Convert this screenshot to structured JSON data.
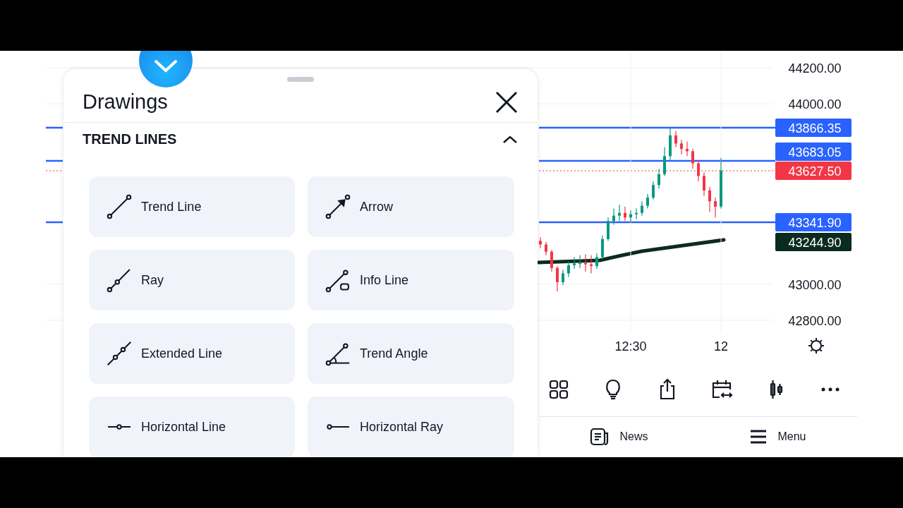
{
  "chart": {
    "chart_data": {
      "type": "candlestick",
      "categories": [
        null,
        null,
        null,
        null,
        null,
        null,
        null,
        null,
        null,
        null,
        null,
        null,
        null,
        null,
        null,
        null,
        "12:30",
        null,
        null,
        null,
        null,
        null,
        null,
        null,
        null,
        null,
        null,
        null,
        null,
        null,
        null,
        null,
        "12"
      ],
      "ohlc": [
        [
          43240,
          43260,
          43200,
          43220
        ],
        [
          43220,
          43235,
          43160,
          43180
        ],
        [
          43180,
          43190,
          43070,
          43090
        ],
        [
          43090,
          43100,
          42960,
          43011
        ],
        [
          43011,
          43080,
          42995,
          43060
        ],
        [
          43060,
          43125,
          43040,
          43105
        ],
        [
          43105,
          43150,
          43085,
          43115
        ],
        [
          43115,
          43160,
          43090,
          43118
        ],
        [
          43118,
          43165,
          43070,
          43110
        ],
        [
          43110,
          43160,
          43060,
          43100
        ],
        [
          43100,
          43170,
          43085,
          43150
        ],
        [
          43150,
          43270,
          43140,
          43250
        ],
        [
          43250,
          43370,
          43240,
          43350
        ],
        [
          43350,
          43420,
          43330,
          43380
        ],
        [
          43380,
          43440,
          43350,
          43395
        ],
        [
          43395,
          43430,
          43350,
          43370
        ],
        [
          43370,
          43410,
          43340,
          43388
        ],
        [
          43388,
          43420,
          43360,
          43395
        ],
        [
          43395,
          43460,
          43380,
          43435
        ],
        [
          43435,
          43500,
          43420,
          43480
        ],
        [
          43480,
          43570,
          43470,
          43550
        ],
        [
          43550,
          43640,
          43530,
          43610
        ],
        [
          43610,
          43760,
          43600,
          43710
        ],
        [
          43710,
          43870,
          43690,
          43825
        ],
        [
          43825,
          43850,
          43760,
          43780
        ],
        [
          43780,
          43800,
          43720,
          43750
        ],
        [
          43750,
          43790,
          43710,
          43737
        ],
        [
          43737,
          43750,
          43640,
          43670
        ],
        [
          43670,
          43690,
          43570,
          43600
        ],
        [
          43600,
          43620,
          43490,
          43520
        ],
        [
          43520,
          43540,
          43400,
          43460
        ],
        [
          43460,
          43480,
          43370,
          43430
        ],
        [
          43430,
          43700,
          43420,
          43630
        ]
      ],
      "ylim": [
        42737,
        44294
      ],
      "yticks": [
        {
          "value": 44200,
          "label": "44200.00"
        },
        {
          "value": 44000,
          "label": "44000.00"
        },
        {
          "value": 43000,
          "label": "43000.00"
        },
        {
          "value": 42800,
          "label": "42800.00"
        }
      ],
      "grid": true
    },
    "levels": [
      {
        "price": "43866.35",
        "color": "#2962ff",
        "kind": "line"
      },
      {
        "price": "43683.05",
        "color": "#2962ff",
        "kind": "line"
      },
      {
        "price": "43627.50",
        "color": "#f23645",
        "kind": "current"
      },
      {
        "price": "43341.90",
        "color": "#2962ff",
        "kind": "line"
      },
      {
        "price": "43244.90",
        "color": "#0b2b1e",
        "kind": "average"
      }
    ]
  },
  "toolbar": [
    {
      "kind": "grid"
    },
    {
      "kind": "idea"
    },
    {
      "kind": "share"
    },
    {
      "kind": "calendar"
    },
    {
      "kind": "candles"
    },
    {
      "kind": "more"
    }
  ],
  "bottom_nav": [
    {
      "label": "News",
      "kind": "news"
    },
    {
      "label": "Menu",
      "kind": "menu"
    }
  ],
  "drawings_panel": {
    "title": "Drawings",
    "section": {
      "title": "TREND LINES",
      "expanded": true
    },
    "tools": [
      {
        "label": "Trend Line",
        "kind": "trend"
      },
      {
        "label": "Arrow",
        "kind": "arrow"
      },
      {
        "label": "Ray",
        "kind": "ray"
      },
      {
        "label": "Info Line",
        "kind": "info"
      },
      {
        "label": "Extended Line",
        "kind": "extended"
      },
      {
        "label": "Trend Angle",
        "kind": "angle"
      },
      {
        "label": "Horizontal Line",
        "kind": "hline"
      },
      {
        "label": "Horizontal Ray",
        "kind": "hray"
      }
    ]
  }
}
